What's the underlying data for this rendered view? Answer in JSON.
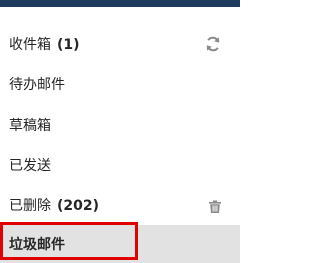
{
  "folders": {
    "inbox": {
      "label": "收件箱",
      "count": "(1)"
    },
    "todo": {
      "label": "待办邮件"
    },
    "drafts": {
      "label": "草稿箱"
    },
    "sent": {
      "label": "已发送"
    },
    "deleted": {
      "label": "已删除",
      "count": "(202)"
    },
    "junk": {
      "label": "垃圾邮件",
      "selected": true
    }
  },
  "icons": {
    "inbox_action": "sync-icon",
    "deleted_action": "trash-icon"
  },
  "colors": {
    "top_bar": "#1f3b5d",
    "selected_bg": "#e2e2e2",
    "highlight_border": "#e00000",
    "icon": "#8a8a8a"
  }
}
